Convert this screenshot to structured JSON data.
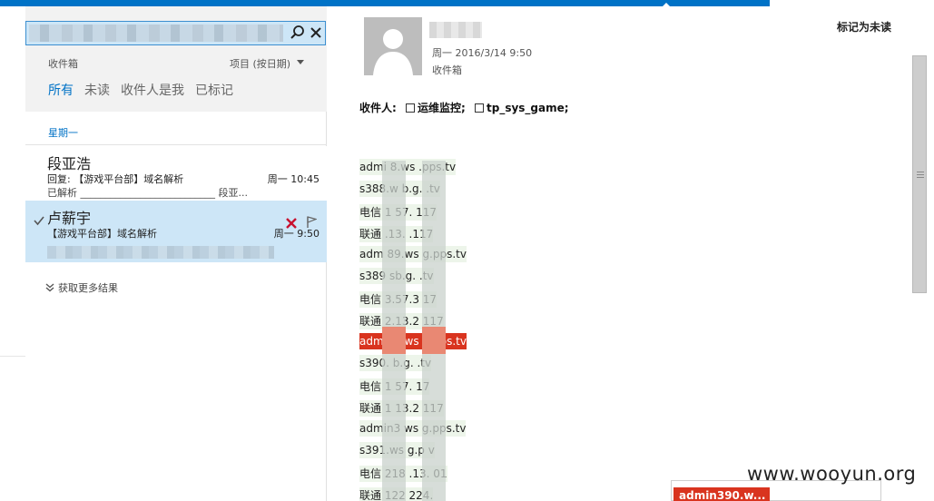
{
  "search": {
    "query": "████████████████"
  },
  "list": {
    "folder": "收件箱",
    "sort": "项目 (按日期)",
    "filters": [
      "所有",
      "未读",
      "收件人是我",
      "已标记"
    ],
    "group": "星期一",
    "items": [
      {
        "sender": "段亚浩",
        "subject": "回复: 【游戏平台部】域名解析",
        "date": "周一 10:45",
        "preview": "已解析 ___________________________ 段亚..."
      },
      {
        "sender": "卢薪宇",
        "subject": "【游戏平台部】域名解析",
        "date": "周一 9:50"
      }
    ],
    "more_results": "获取更多结果"
  },
  "reading": {
    "date": "周一 2016/3/14 9:50",
    "folder": "收件箱",
    "mark_unread": "标记为未读",
    "recipients_label": "收件人:",
    "recipients": [
      "运维监控;",
      "tp_sys_game;"
    ],
    "lines": [
      "admi    8.ws     .pps.tv",
      "s388.w     b.g.     .tv",
      "电信 1    57.     117",
      "联通     .13.     .117",
      "adm    89.ws    g.pps.tv",
      "s389     sb.g.     .tv",
      "电信      3.57.3     17",
      "联通     2.13.2     117",
      "adm     90.ws     g.pps.tv",
      "s390.     b.g.     .tv",
      "电信 1    57.     17",
      "联通 1    13.2     117",
      "admin3     ws     g.pps.tv",
      "s391.ws     g.p     v",
      "电信 218     .13.     01",
      "联通 122     224."
    ],
    "highlight_index": 8,
    "popup": "admin390.w..."
  },
  "watermark": "www.wooyun.org"
}
